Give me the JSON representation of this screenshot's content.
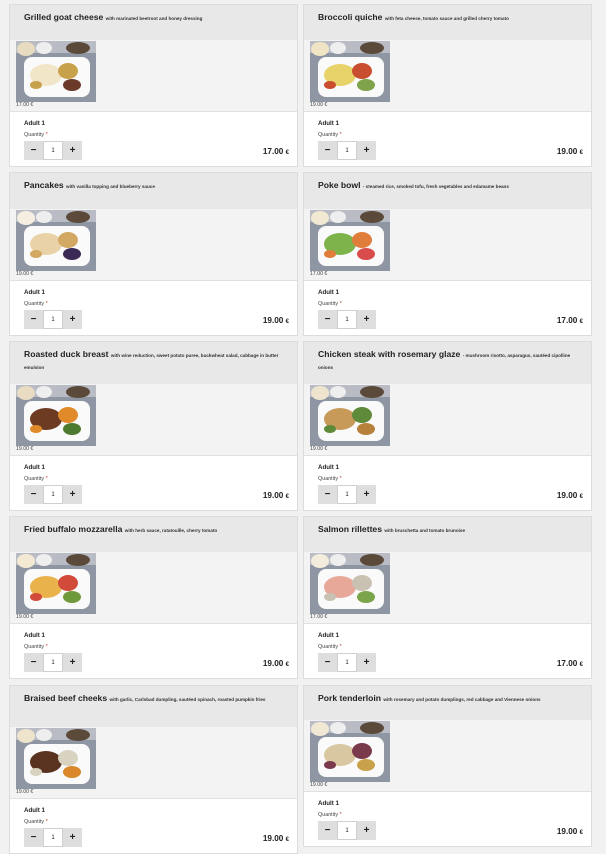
{
  "menu_items": [
    {
      "name": "Grilled goat cheese",
      "description": "with marinated beetroot and honey dressing",
      "unit_price": "17.00 €",
      "passenger": "Adult 1",
      "quantity_label": "Quantity",
      "required_mark": "*",
      "quantity": "1",
      "total": "17.00",
      "currency": "€",
      "image_icon": "meal-tray-photo"
    },
    {
      "name": "Broccoli quiche",
      "description": "with feta cheese, tomato sauce and grilled cherry tomato",
      "unit_price": "19.00 €",
      "passenger": "Adult 1",
      "quantity_label": "Quantity",
      "required_mark": "*",
      "quantity": "1",
      "total": "19.00",
      "currency": "€",
      "image_icon": "meal-tray-photo"
    },
    {
      "name": "Pancakes",
      "description": "with vanilla topping and blueberry sauce",
      "unit_price": "19.00 €",
      "passenger": "Adult 1",
      "quantity_label": "Quantity",
      "required_mark": "*",
      "quantity": "1",
      "total": "19.00",
      "currency": "€",
      "image_icon": "meal-tray-photo"
    },
    {
      "name": "Poke bowl",
      "description": "- steamed rice, smoked tofu, fresh vegetables and edamame beans",
      "unit_price": "17.00 €",
      "passenger": "Adult 1",
      "quantity_label": "Quantity",
      "required_mark": "*",
      "quantity": "1",
      "total": "17.00",
      "currency": "€",
      "image_icon": "meal-tray-photo"
    },
    {
      "name": "Roasted duck breast",
      "description": "with wine reduction, sweet potato puree, buckwheat salad, cabbage in butter emulsion",
      "unit_price": "19.00 €",
      "passenger": "Adult 1",
      "quantity_label": "Quantity",
      "required_mark": "*",
      "quantity": "1",
      "total": "19.00",
      "currency": "€",
      "image_icon": "meal-tray-photo"
    },
    {
      "name": "Chicken steak with rosemary glaze",
      "description": "- mushroom risotto, asparagus, sautéed cipolline onions",
      "unit_price": "19.00 €",
      "passenger": "Adult 1",
      "quantity_label": "Quantity",
      "required_mark": "*",
      "quantity": "1",
      "total": "19.00",
      "currency": "€",
      "image_icon": "meal-tray-photo"
    },
    {
      "name": "Fried buffalo mozzarella",
      "description": "with herb sauce, ratatouille, cherry tomato",
      "unit_price": "19.00 €",
      "passenger": "Adult 1",
      "quantity_label": "Quantity",
      "required_mark": "*",
      "quantity": "1",
      "total": "19.00",
      "currency": "€",
      "image_icon": "meal-tray-photo"
    },
    {
      "name": "Salmon rillettes",
      "description": "with bruschetta and tomato brunoise",
      "unit_price": "17.00 €",
      "passenger": "Adult 1",
      "quantity_label": "Quantity",
      "required_mark": "*",
      "quantity": "1",
      "total": "17.00",
      "currency": "€",
      "image_icon": "meal-tray-photo"
    },
    {
      "name": "Braised beef cheeks",
      "description": "with garlic, Carlsbad dumpling, sautéed spinach, roasted pumpkin fries",
      "unit_price": "19.00 €",
      "passenger": "Adult 1",
      "quantity_label": "Quantity",
      "required_mark": "*",
      "quantity": "1",
      "total": "19.00",
      "currency": "€",
      "image_icon": "meal-tray-photo"
    },
    {
      "name": "Pork tenderloin",
      "description": "with rosemary and potato dumplings, red cabbage and Viennese onions",
      "unit_price": "19.00 €",
      "passenger": "Adult 1",
      "quantity_label": "Quantity",
      "required_mark": "*",
      "quantity": "1",
      "total": "19.00",
      "currency": "€",
      "image_icon": "meal-tray-photo"
    }
  ],
  "controls": {
    "minus_label": "−",
    "plus_label": "+"
  },
  "colors": {
    "header_bg": "#e8e8e8",
    "photo_bg": "#9aa0ab",
    "required": "#c0392b"
  }
}
